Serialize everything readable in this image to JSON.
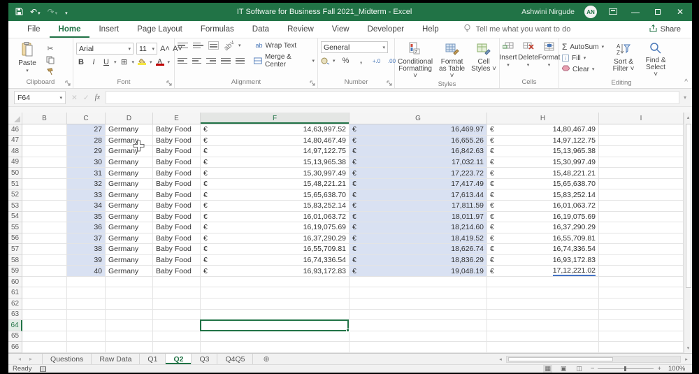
{
  "title_bar": {
    "title": "IT Software for Business Fall 2021_Midterm  -  Excel",
    "user_name": "Ashwini Nirgude",
    "avatar_initials": "AN"
  },
  "ribbon_tabs": {
    "items": [
      "File",
      "Home",
      "Insert",
      "Page Layout",
      "Formulas",
      "Data",
      "Review",
      "View",
      "Developer",
      "Help"
    ],
    "active": "Home",
    "tell_me": "Tell me what you want to do",
    "share": "Share"
  },
  "ribbon": {
    "clipboard": {
      "group": "Clipboard",
      "paste": "Paste"
    },
    "font": {
      "group": "Font",
      "font_name": "Arial",
      "font_size": "11",
      "bold": "B",
      "italic": "I",
      "underline": "U"
    },
    "alignment": {
      "group": "Alignment",
      "wrap_text": "Wrap Text",
      "merge_center": "Merge & Center"
    },
    "number": {
      "group": "Number",
      "format": "General"
    },
    "styles": {
      "group": "Styles",
      "conditional": "Conditional Formatting ˅",
      "format_table": "Format as Table ˅",
      "cell_styles": "Cell Styles ˅"
    },
    "cells": {
      "group": "Cells",
      "insert": "Insert",
      "delete": "Delete",
      "format": "Format"
    },
    "editing": {
      "group": "Editing",
      "autosum": "AutoSum",
      "fill": "Fill",
      "clear": "Clear",
      "sort_filter": "Sort & Filter ˅",
      "find_select": "Find & Select ˅"
    }
  },
  "formula_bar": {
    "name_box": "F64",
    "fx_label": "fx",
    "formula_value": ""
  },
  "grid": {
    "columns": [
      "B",
      "C",
      "D",
      "E",
      "F",
      "G",
      "H",
      "I"
    ],
    "selected_column": "F",
    "row_start": 46,
    "row_count": 21,
    "active_row": 64,
    "active_cell": "F64",
    "currency": "€",
    "rows": [
      {
        "row": 46,
        "c": "27",
        "d": "Germany",
        "e": "Baby Food",
        "f": "14,63,997.52",
        "g": "16,469.97",
        "h": "14,80,467.49"
      },
      {
        "row": 47,
        "c": "28",
        "d": "Germany",
        "e": "Baby Food",
        "f": "14,80,467.49",
        "g": "16,655.26",
        "h": "14,97,122.75"
      },
      {
        "row": 48,
        "c": "29",
        "d": "Germany",
        "e": "Baby Food",
        "f": "14,97,122.75",
        "g": "16,842.63",
        "h": "15,13,965.38"
      },
      {
        "row": 49,
        "c": "30",
        "d": "Germany",
        "e": "Baby Food",
        "f": "15,13,965.38",
        "g": "17,032.11",
        "h": "15,30,997.49"
      },
      {
        "row": 50,
        "c": "31",
        "d": "Germany",
        "e": "Baby Food",
        "f": "15,30,997.49",
        "g": "17,223.72",
        "h": "15,48,221.21"
      },
      {
        "row": 51,
        "c": "32",
        "d": "Germany",
        "e": "Baby Food",
        "f": "15,48,221.21",
        "g": "17,417.49",
        "h": "15,65,638.70"
      },
      {
        "row": 52,
        "c": "33",
        "d": "Germany",
        "e": "Baby Food",
        "f": "15,65,638.70",
        "g": "17,613.44",
        "h": "15,83,252.14"
      },
      {
        "row": 53,
        "c": "34",
        "d": "Germany",
        "e": "Baby Food",
        "f": "15,83,252.14",
        "g": "17,811.59",
        "h": "16,01,063.72"
      },
      {
        "row": 54,
        "c": "35",
        "d": "Germany",
        "e": "Baby Food",
        "f": "16,01,063.72",
        "g": "18,011.97",
        "h": "16,19,075.69"
      },
      {
        "row": 55,
        "c": "36",
        "d": "Germany",
        "e": "Baby Food",
        "f": "16,19,075.69",
        "g": "18,214.60",
        "h": "16,37,290.29"
      },
      {
        "row": 56,
        "c": "37",
        "d": "Germany",
        "e": "Baby Food",
        "f": "16,37,290.29",
        "g": "18,419.52",
        "h": "16,55,709.81"
      },
      {
        "row": 57,
        "c": "38",
        "d": "Germany",
        "e": "Baby Food",
        "f": "16,55,709.81",
        "g": "18,626.74",
        "h": "16,74,336.54"
      },
      {
        "row": 58,
        "c": "39",
        "d": "Germany",
        "e": "Baby Food",
        "f": "16,74,336.54",
        "g": "18,836.29",
        "h": "16,93,172.83"
      },
      {
        "row": 59,
        "c": "40",
        "d": "Germany",
        "e": "Baby Food",
        "f": "16,93,172.83",
        "g": "19,048.19",
        "h": "17,12,221.02"
      }
    ]
  },
  "sheet_tabs": {
    "items": [
      "Questions",
      "Raw Data",
      "Q1",
      "Q2",
      "Q3",
      "Q4Q5"
    ],
    "active": "Q2"
  },
  "status_bar": {
    "mode": "Ready",
    "zoom_level": "100%"
  },
  "icons": {
    "undo": "↶",
    "redo": "↷",
    "dropdown": "▾",
    "cut": "✂",
    "sigma": "Σ",
    "plus_circle": "⊕",
    "up_arrow": "▴",
    "down_arrow": "▾",
    "left_arrow": "◂",
    "right_arrow": "▸",
    "check": "✓",
    "cancel": "✕",
    "minimize": "—",
    "close": "✕",
    "collapse": "^",
    "percent": "%",
    "comma": ",",
    "increase_decimal": "+.0",
    "decrease_decimal": ".00",
    "borders": "⊞",
    "fill_down": "↓",
    "grid_view": "▦",
    "layout_view": "▣",
    "break_view": "◫",
    "grow_font": "A˄",
    "shrink_font": "A˅",
    "orientation": "ab˅",
    "wrap_ab": "ab"
  },
  "colors": {
    "excel_green": "#217346",
    "selection_fill": "#d9e1f2",
    "active_cell_border": "#217346",
    "h_underline_blue": "#4472c4",
    "fill_color_swatch": "#f5e642",
    "font_color_swatch": "#c00000"
  }
}
